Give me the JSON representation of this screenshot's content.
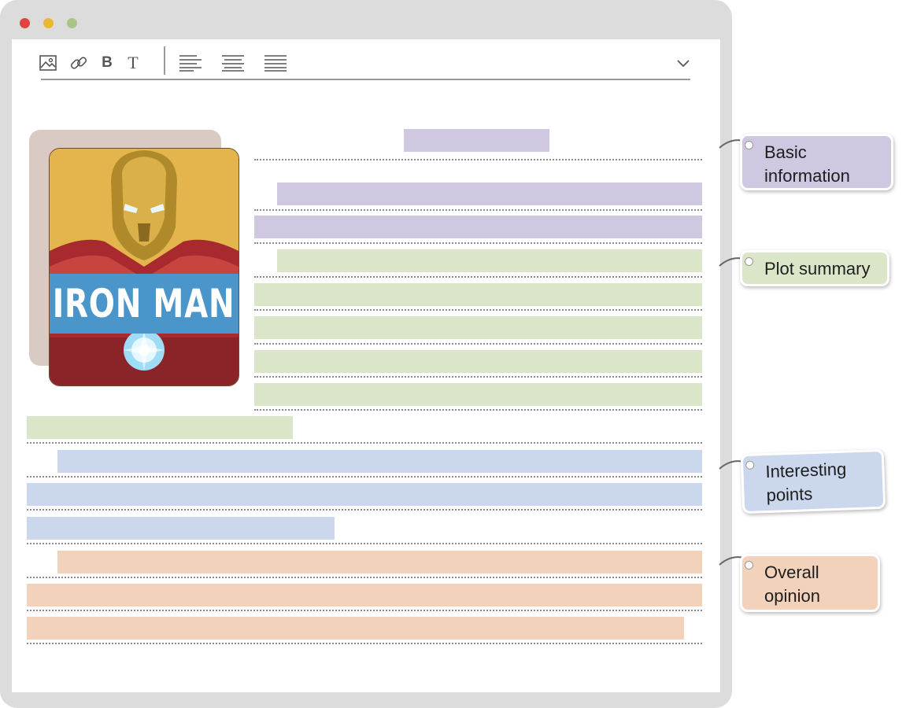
{
  "poster": {
    "title": "IRON MAN"
  },
  "toolbar": {
    "bold_label": "B",
    "text_label": "T"
  },
  "callouts": {
    "basic": "Basic information",
    "plot": "Plot summary",
    "interesting": "Interesting points",
    "opinion": "Overall opinion"
  },
  "colors": {
    "basic": "#d0c7e0",
    "plot": "#dbe6c9",
    "interesting": "#cbd7ed",
    "opinion": "#f3d2bb"
  }
}
